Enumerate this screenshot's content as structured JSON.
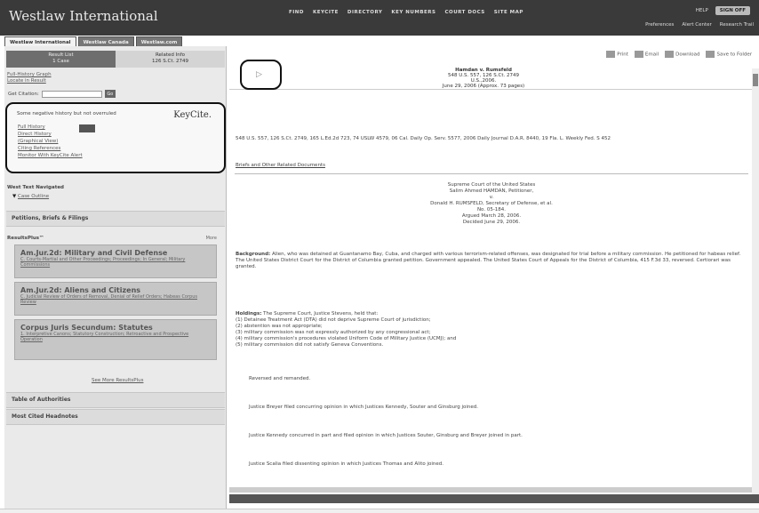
{
  "brand": "Westlaw International",
  "topnav": [
    "FIND",
    "KEYCITE",
    "DIRECTORY",
    "KEY NUMBERS",
    "COURT DOCS",
    "SITE MAP"
  ],
  "topright": {
    "help": "HELP",
    "signoff": "SIGN OFF"
  },
  "topright2": [
    "Preferences",
    "Alert Center",
    "Research Trail"
  ],
  "tabs": [
    "Westlaw International",
    "Westlaw Canada",
    "Westlaw.com"
  ],
  "left": {
    "tab_result": "Result List",
    "tab_result_sub": "1 Case",
    "tab_related": "Related Info",
    "tab_related_sub": "126 S.Ct. 2749",
    "small_links": [
      "Full-History Graph",
      "Locate in Result"
    ],
    "search_label": "Get Citation:",
    "search_value": "",
    "go_label": "Go",
    "keycite_msg": "Some negative history but not overruled",
    "keycite_logo": "KeyCite.",
    "keycite_links": [
      "Full History",
      "Direct History",
      "(Graphical View)",
      "Citing References",
      "Monitor With KeyCite Alert"
    ],
    "alltext_title": "West Text Navigated",
    "alltext_link": "Case Outline",
    "petitions": "Petitions, Briefs & Filings",
    "resultsplus_title": "ResultsPlus™",
    "resultsplus_more": "More",
    "rp_items": [
      {
        "title": "Am.Jur.2d: Military and Civil Defense",
        "desc": "C. Courts-Martial and Other Proceedings; Proceedings; In General; Military Commissions"
      },
      {
        "title": "Am.Jur.2d: Aliens and Citizens",
        "desc": "C. Judicial Review of Orders of Removal, Denial of Relief Orders; Habeas Corpus Review"
      },
      {
        "title": "Corpus Juris Secundum: Statutes",
        "desc": "1. Interpretive Canons; Statutory Construction; Retroactive and Prospective Operation"
      }
    ],
    "see_more": "See More ResultsPlus",
    "table_of_authorities": "Table of Authorities",
    "most_cited": "Most Cited Headnotes"
  },
  "right": {
    "tools": [
      "Print",
      "Email",
      "Download",
      "Save to Folder"
    ],
    "case_name": "Hamdan v. Rumsfeld",
    "case_cite": "548 U.S. 557, 126 S.Ct. 2749",
    "case_cite2": "U.S.,2006.",
    "case_date": "June 29, 2006 (Approx. 73 pages)",
    "cites_line": "548 U.S. 557, 126 S.Ct. 2749, 165 L.Ed.2d 723, 74 USLW 4579, 06 Cal. Daily Op. Serv. 5577, 2006 Daily Journal D.A.R. 8440, 19 Fla. L. Weekly Fed. S 452",
    "briefs_link": "Briefs and Other Related Documents",
    "court": "Supreme Court of the United States",
    "party1": "Salim Ahmed HAMDAN, Petitioner,",
    "v": "v.",
    "party2": "Donald H. RUMSFELD, Secretary of Defense, et al.",
    "docket": "No. 05-184.",
    "argued": "Argued March 28, 2006.",
    "decided": "Decided June 29, 2006.",
    "background_label": "Background:",
    "background_text": "Alien, who was detained at Guantanamo Bay, Cuba, and charged with various terrorism-related offenses, was designated for trial before a military commission. He petitioned for habeas relief. The United States District Court for the District of Columbia granted petition. Government appealed. The United States Court of Appeals for the District of Columbia, 415 F.3d 33, reversed. Certiorari was granted.",
    "holdings_label": "Holdings:",
    "holdings_intro": "The Supreme Court, Justice Stevens, held that:",
    "holdings": [
      "(1) Detainee Treatment Act (DTA) did not deprive Supreme Court of jurisdiction;",
      "(2) abstention was not appropriate;",
      "(3) military commission was not expressly authorized by any congressional act;",
      "(4) military commission's procedures violated Uniform Code of Military Justice (UCMJ); and",
      "(5) military commission did not satisfy Geneva Conventions."
    ],
    "reversed": "Reversed and remanded.",
    "op1": "Justice Breyer filed concurring opinion in which Justices Kennedy, Souter and Ginsburg joined.",
    "op2": "Justice Kennedy concurred in part and filed opinion in which Justices Souter, Ginsburg and Breyer joined in part.",
    "op3": "Justice Scalia filed dissenting opinion in which Justices Thomas and Alito joined."
  }
}
